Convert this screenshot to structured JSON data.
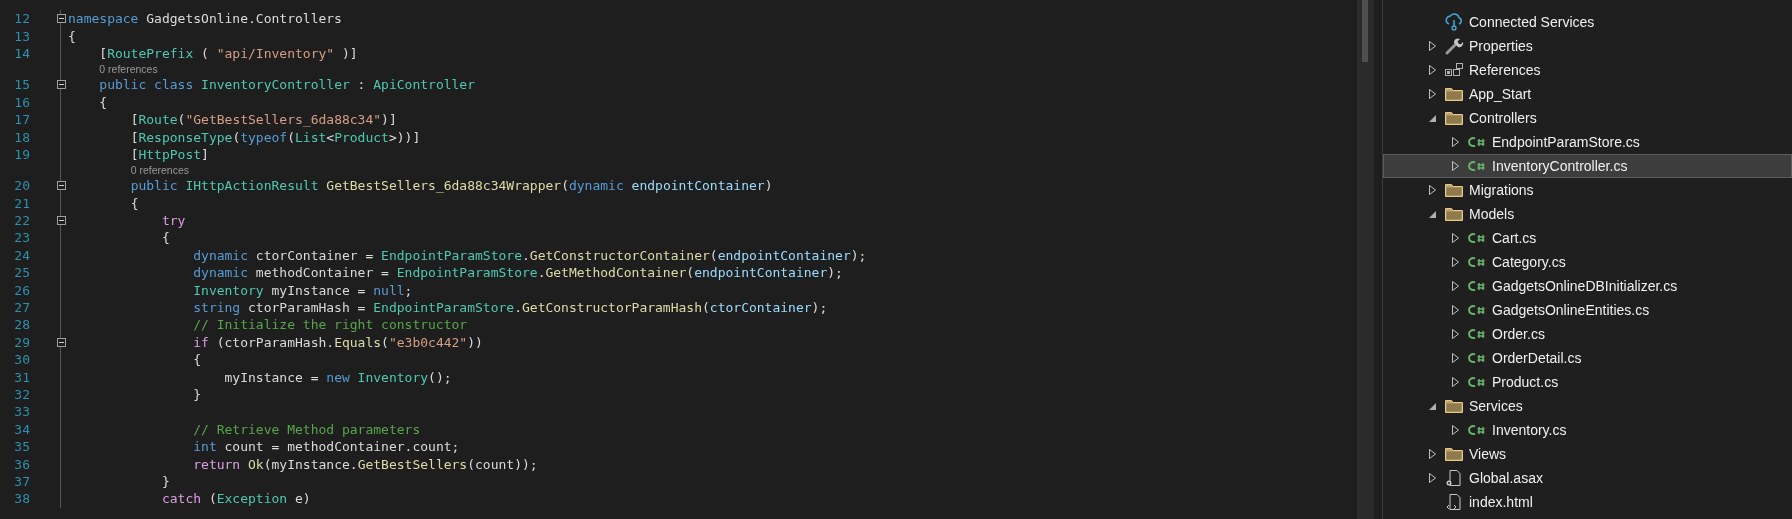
{
  "editor": {
    "lines": [
      {
        "kind": "code",
        "number": "12",
        "fold": true,
        "tokens": [
          {
            "kind": "keyword",
            "text": "namespace"
          },
          {
            "kind": "plain",
            "text": " GadgetsOnline.Controllers"
          }
        ]
      },
      {
        "kind": "code",
        "number": "13",
        "fold": false,
        "tokens": [
          {
            "kind": "plain",
            "text": "{"
          }
        ]
      },
      {
        "kind": "code",
        "number": "14",
        "fold": false,
        "tokens": [
          {
            "kind": "plain",
            "text": "    ["
          },
          {
            "kind": "type",
            "text": "RoutePrefix"
          },
          {
            "kind": "plain",
            "text": " ( "
          },
          {
            "kind": "string",
            "text": "\"api/Inventory\""
          },
          {
            "kind": "plain",
            "text": " )]"
          }
        ]
      },
      {
        "kind": "codelens",
        "text": "    0 references"
      },
      {
        "kind": "code",
        "number": "15",
        "fold": true,
        "tokens": [
          {
            "kind": "keyword",
            "text": "    public"
          },
          {
            "kind": "keyword",
            "text": " class"
          },
          {
            "kind": "type",
            "text": " InventoryController"
          },
          {
            "kind": "plain",
            "text": " : "
          },
          {
            "kind": "type",
            "text": "ApiController"
          }
        ]
      },
      {
        "kind": "code",
        "number": "16",
        "fold": false,
        "tokens": [
          {
            "kind": "plain",
            "text": "    {"
          }
        ]
      },
      {
        "kind": "code",
        "number": "17",
        "fold": false,
        "tokens": [
          {
            "kind": "plain",
            "text": "        ["
          },
          {
            "kind": "type",
            "text": "Route"
          },
          {
            "kind": "plain",
            "text": "("
          },
          {
            "kind": "string",
            "text": "\"GetBestSellers_6da88c34\""
          },
          {
            "kind": "plain",
            "text": ")]"
          }
        ]
      },
      {
        "kind": "code",
        "number": "18",
        "fold": false,
        "tokens": [
          {
            "kind": "plain",
            "text": "        ["
          },
          {
            "kind": "type",
            "text": "ResponseType"
          },
          {
            "kind": "plain",
            "text": "("
          },
          {
            "kind": "keyword",
            "text": "typeof"
          },
          {
            "kind": "plain",
            "text": "("
          },
          {
            "kind": "type",
            "text": "List"
          },
          {
            "kind": "plain",
            "text": "<"
          },
          {
            "kind": "type",
            "text": "Product"
          },
          {
            "kind": "plain",
            "text": ">))]"
          }
        ]
      },
      {
        "kind": "code",
        "number": "19",
        "fold": false,
        "tokens": [
          {
            "kind": "plain",
            "text": "        ["
          },
          {
            "kind": "type",
            "text": "HttpPost"
          },
          {
            "kind": "plain",
            "text": "]"
          }
        ]
      },
      {
        "kind": "codelens",
        "text": "        0 references"
      },
      {
        "kind": "code",
        "number": "20",
        "fold": true,
        "tokens": [
          {
            "kind": "keyword",
            "text": "        public"
          },
          {
            "kind": "type",
            "text": " IHttpActionResult"
          },
          {
            "kind": "method",
            "text": " GetBestSellers_6da88c34Wrapper"
          },
          {
            "kind": "plain",
            "text": "("
          },
          {
            "kind": "keyword",
            "text": "dynamic"
          },
          {
            "kind": "parameter",
            "text": " endpointContainer"
          },
          {
            "kind": "plain",
            "text": ")"
          }
        ]
      },
      {
        "kind": "code",
        "number": "21",
        "fold": false,
        "tokens": [
          {
            "kind": "plain",
            "text": "        {"
          }
        ]
      },
      {
        "kind": "code",
        "number": "22",
        "fold": true,
        "tokens": [
          {
            "kind": "control",
            "text": "            try"
          }
        ]
      },
      {
        "kind": "code",
        "number": "23",
        "fold": false,
        "tokens": [
          {
            "kind": "plain",
            "text": "            {"
          }
        ]
      },
      {
        "kind": "code",
        "number": "24",
        "fold": false,
        "tokens": [
          {
            "kind": "keyword",
            "text": "                dynamic"
          },
          {
            "kind": "local",
            "text": " ctorContainer"
          },
          {
            "kind": "plain",
            "text": " = "
          },
          {
            "kind": "type",
            "text": "EndpointParamStore"
          },
          {
            "kind": "plain",
            "text": "."
          },
          {
            "kind": "method",
            "text": "GetConstructorContainer"
          },
          {
            "kind": "plain",
            "text": "("
          },
          {
            "kind": "parameter",
            "text": "endpointContainer"
          },
          {
            "kind": "plain",
            "text": ");"
          }
        ]
      },
      {
        "kind": "code",
        "number": "25",
        "fold": false,
        "tokens": [
          {
            "kind": "keyword",
            "text": "                dynamic"
          },
          {
            "kind": "local",
            "text": " methodContainer"
          },
          {
            "kind": "plain",
            "text": " = "
          },
          {
            "kind": "type",
            "text": "EndpointParamStore"
          },
          {
            "kind": "plain",
            "text": "."
          },
          {
            "kind": "method",
            "text": "GetMethodContainer"
          },
          {
            "kind": "plain",
            "text": "("
          },
          {
            "kind": "parameter",
            "text": "endpointContainer"
          },
          {
            "kind": "plain",
            "text": ");"
          }
        ]
      },
      {
        "kind": "code",
        "number": "26",
        "fold": false,
        "tokens": [
          {
            "kind": "type",
            "text": "                Inventory"
          },
          {
            "kind": "local",
            "text": " myInstance"
          },
          {
            "kind": "plain",
            "text": " = "
          },
          {
            "kind": "keyword",
            "text": "null"
          },
          {
            "kind": "plain",
            "text": ";"
          }
        ]
      },
      {
        "kind": "code",
        "number": "27",
        "fold": false,
        "tokens": [
          {
            "kind": "keyword",
            "text": "                string"
          },
          {
            "kind": "local",
            "text": " ctorParamHash"
          },
          {
            "kind": "plain",
            "text": " = "
          },
          {
            "kind": "type",
            "text": "EndpointParamStore"
          },
          {
            "kind": "plain",
            "text": "."
          },
          {
            "kind": "method",
            "text": "GetConstructorParamHash"
          },
          {
            "kind": "plain",
            "text": "("
          },
          {
            "kind": "parameter",
            "text": "ctorContainer"
          },
          {
            "kind": "plain",
            "text": ");"
          }
        ]
      },
      {
        "kind": "code",
        "number": "28",
        "fold": false,
        "tokens": [
          {
            "kind": "comment",
            "text": "                // Initialize the right constructor"
          }
        ]
      },
      {
        "kind": "code",
        "number": "29",
        "fold": true,
        "tokens": [
          {
            "kind": "control",
            "text": "                if"
          },
          {
            "kind": "plain",
            "text": " ("
          },
          {
            "kind": "local",
            "text": "ctorParamHash"
          },
          {
            "kind": "plain",
            "text": "."
          },
          {
            "kind": "method",
            "text": "Equals"
          },
          {
            "kind": "plain",
            "text": "("
          },
          {
            "kind": "string",
            "text": "\"e3b0c442\""
          },
          {
            "kind": "plain",
            "text": "))"
          }
        ]
      },
      {
        "kind": "code",
        "number": "30",
        "fold": false,
        "tokens": [
          {
            "kind": "plain",
            "text": "                {"
          }
        ]
      },
      {
        "kind": "code",
        "number": "31",
        "fold": false,
        "tokens": [
          {
            "kind": "local",
            "text": "                    myInstance"
          },
          {
            "kind": "plain",
            "text": " = "
          },
          {
            "kind": "keyword",
            "text": "new"
          },
          {
            "kind": "type",
            "text": " Inventory"
          },
          {
            "kind": "plain",
            "text": "();"
          }
        ]
      },
      {
        "kind": "code",
        "number": "32",
        "fold": false,
        "tokens": [
          {
            "kind": "plain",
            "text": "                }"
          }
        ]
      },
      {
        "kind": "code",
        "number": "33",
        "fold": false
      },
      {
        "kind": "code",
        "number": "34",
        "fold": false,
        "tokens": [
          {
            "kind": "comment",
            "text": "                // Retrieve Method parameters"
          }
        ]
      },
      {
        "kind": "code",
        "number": "35",
        "fold": false,
        "tokens": [
          {
            "kind": "keyword",
            "text": "                int"
          },
          {
            "kind": "local",
            "text": " count"
          },
          {
            "kind": "plain",
            "text": " = "
          },
          {
            "kind": "local",
            "text": "methodContainer"
          },
          {
            "kind": "plain",
            "text": ".count;"
          }
        ]
      },
      {
        "kind": "code",
        "number": "36",
        "fold": false,
        "tokens": [
          {
            "kind": "control",
            "text": "                return"
          },
          {
            "kind": "method",
            "text": " Ok"
          },
          {
            "kind": "plain",
            "text": "("
          },
          {
            "kind": "local",
            "text": "myInstance"
          },
          {
            "kind": "plain",
            "text": "."
          },
          {
            "kind": "method",
            "text": "GetBestSellers"
          },
          {
            "kind": "plain",
            "text": "("
          },
          {
            "kind": "local",
            "text": "count"
          },
          {
            "kind": "plain",
            "text": "));"
          }
        ]
      },
      {
        "kind": "code",
        "number": "37",
        "fold": false,
        "tokens": [
          {
            "kind": "plain",
            "text": "            }"
          }
        ]
      },
      {
        "kind": "code",
        "number": "38",
        "fold": false,
        "tokens": [
          {
            "kind": "control",
            "text": "            catch"
          },
          {
            "kind": "plain",
            "text": " ("
          },
          {
            "kind": "type",
            "text": "Exception"
          },
          {
            "kind": "local",
            "text": " e"
          },
          {
            "kind": "plain",
            "text": ")"
          }
        ]
      }
    ]
  },
  "solution_explorer": {
    "items": [
      {
        "label": "Connected Services",
        "kind": "service",
        "expandable": false,
        "selected": false
      },
      {
        "label": "Properties",
        "kind": "properties",
        "expandable": true,
        "expanded": false,
        "selected": false
      },
      {
        "label": "References",
        "kind": "references",
        "expandable": true,
        "expanded": false,
        "selected": false
      },
      {
        "label": "App_Start",
        "kind": "folder",
        "expandable": true,
        "expanded": false,
        "selected": false
      },
      {
        "label": "Controllers",
        "kind": "folder",
        "expandable": true,
        "expanded": true,
        "selected": false,
        "children": [
          {
            "label": "EndpointParamStore.cs",
            "kind": "csharp",
            "expandable": true,
            "expanded": false,
            "selected": false
          },
          {
            "label": "InventoryController.cs",
            "kind": "csharp",
            "expandable": true,
            "expanded": false,
            "selected": true
          }
        ]
      },
      {
        "label": "Migrations",
        "kind": "folder",
        "expandable": true,
        "expanded": false,
        "selected": false
      },
      {
        "label": "Models",
        "kind": "folder",
        "expandable": true,
        "expanded": true,
        "selected": false,
        "children": [
          {
            "label": "Cart.cs",
            "kind": "csharp",
            "expandable": true,
            "expanded": false,
            "selected": false
          },
          {
            "label": "Category.cs",
            "kind": "csharp",
            "expandable": true,
            "expanded": false,
            "selected": false
          },
          {
            "label": "GadgetsOnlineDBInitializer.cs",
            "kind": "csharp",
            "expandable": true,
            "expanded": false,
            "selected": false
          },
          {
            "label": "GadgetsOnlineEntities.cs",
            "kind": "csharp",
            "expandable": true,
            "expanded": false,
            "selected": false
          },
          {
            "label": "Order.cs",
            "kind": "csharp",
            "expandable": true,
            "expanded": false,
            "selected": false
          },
          {
            "label": "OrderDetail.cs",
            "kind": "csharp",
            "expandable": true,
            "expanded": false,
            "selected": false
          },
          {
            "label": "Product.cs",
            "kind": "csharp",
            "expandable": true,
            "expanded": false,
            "selected": false
          }
        ]
      },
      {
        "label": "Services",
        "kind": "folder",
        "expandable": true,
        "expanded": true,
        "selected": false,
        "children": [
          {
            "label": "Inventory.cs",
            "kind": "csharp",
            "expandable": true,
            "expanded": false,
            "selected": false
          }
        ]
      },
      {
        "label": "Views",
        "kind": "folder",
        "expandable": true,
        "expanded": false,
        "selected": false
      },
      {
        "label": "Global.asax",
        "kind": "asax",
        "expandable": true,
        "expanded": false,
        "selected": false
      },
      {
        "label": "index.html",
        "kind": "html",
        "expandable": false,
        "selected": false
      }
    ]
  }
}
